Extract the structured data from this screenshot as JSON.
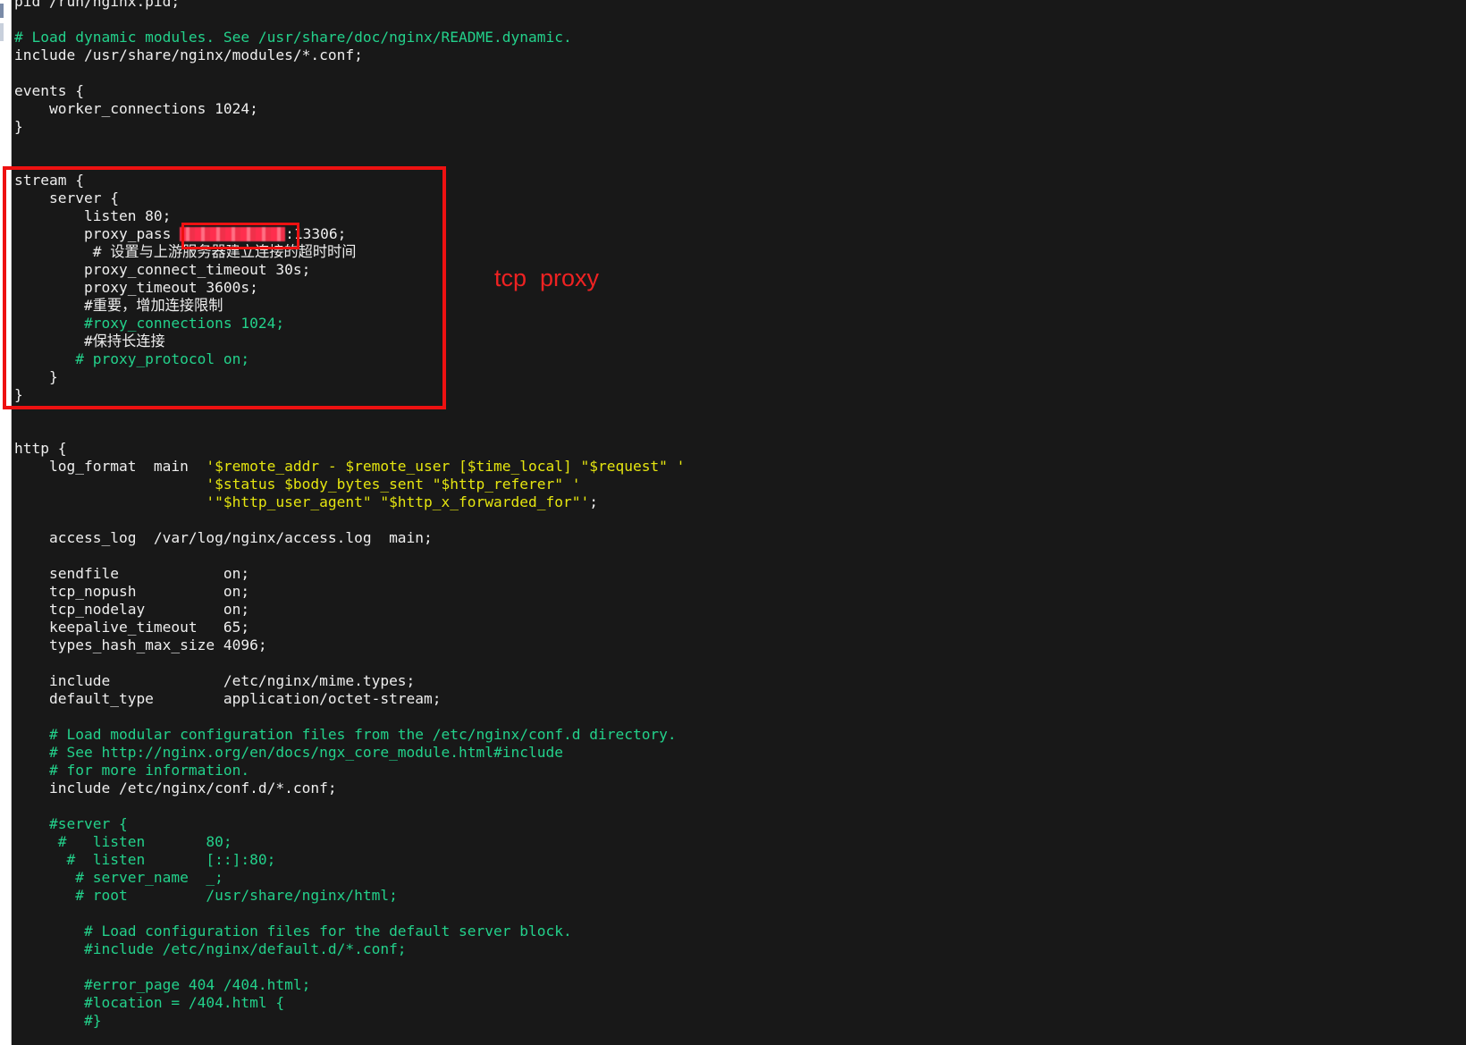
{
  "colors": {
    "background": "#181818",
    "text": "#eeeeee",
    "comment": "#23d18b",
    "string": "#e5e510",
    "annotation": "#ee2222"
  },
  "annotation": {
    "label": "tcp  proxy"
  },
  "code": {
    "lines": [
      [
        {
          "t": "pid /run/nginx.pid;",
          "c": "plain"
        }
      ],
      [],
      [
        {
          "t": "# Load dynamic modules. See /usr/share/doc/nginx/README.dynamic.",
          "c": "comment"
        }
      ],
      [
        {
          "t": "include /usr/share/nginx/modules/*.conf;",
          "c": "plain"
        }
      ],
      [],
      [
        {
          "t": "events {",
          "c": "plain"
        }
      ],
      [
        {
          "t": "    worker_connections 1024;",
          "c": "plain"
        }
      ],
      [
        {
          "t": "}",
          "c": "plain"
        }
      ],
      [],
      [],
      [
        {
          "t": "stream {",
          "c": "plain"
        }
      ],
      [
        {
          "t": "    server {",
          "c": "plain"
        }
      ],
      [
        {
          "t": "        listen 80;",
          "c": "plain"
        }
      ],
      [
        {
          "t": "        proxy_pass ",
          "c": "plain"
        },
        {
          "t": "",
          "c": "redacted"
        },
        {
          "t": ":13306;",
          "c": "plain"
        }
      ],
      [
        {
          "t": "         # 设置与上游服务器建立连接的超时时间",
          "c": "plain"
        }
      ],
      [
        {
          "t": "        proxy_connect_timeout 30s;",
          "c": "plain"
        }
      ],
      [
        {
          "t": "        proxy_timeout 3600s;",
          "c": "plain"
        }
      ],
      [
        {
          "t": "        #重要，增加连接限制",
          "c": "plain"
        }
      ],
      [
        {
          "t": "        #roxy_connections 1024;",
          "c": "comment"
        }
      ],
      [
        {
          "t": "        #保持长连接",
          "c": "plain"
        }
      ],
      [
        {
          "t": "       # proxy_protocol on;",
          "c": "comment"
        }
      ],
      [
        {
          "t": "    }",
          "c": "plain"
        }
      ],
      [
        {
          "t": "}",
          "c": "plain"
        }
      ],
      [],
      [],
      [
        {
          "t": "http {",
          "c": "plain"
        }
      ],
      [
        {
          "t": "    log_format  main  ",
          "c": "plain"
        },
        {
          "t": "'$remote_addr - $remote_user [$time_local] \"$request\" '",
          "c": "str"
        }
      ],
      [
        {
          "t": "                      ",
          "c": "plain"
        },
        {
          "t": "'$status $body_bytes_sent \"$http_referer\" '",
          "c": "str"
        }
      ],
      [
        {
          "t": "                      ",
          "c": "plain"
        },
        {
          "t": "'\"$http_user_agent\" \"$http_x_forwarded_for\"'",
          "c": "str"
        },
        {
          "t": ";",
          "c": "plain"
        }
      ],
      [],
      [
        {
          "t": "    access_log  /var/log/nginx/access.log  main;",
          "c": "plain"
        }
      ],
      [],
      [
        {
          "t": "    sendfile            on;",
          "c": "plain"
        }
      ],
      [
        {
          "t": "    tcp_nopush          on;",
          "c": "plain"
        }
      ],
      [
        {
          "t": "    tcp_nodelay         on;",
          "c": "plain"
        }
      ],
      [
        {
          "t": "    keepalive_timeout   65;",
          "c": "plain"
        }
      ],
      [
        {
          "t": "    types_hash_max_size 4096;",
          "c": "plain"
        }
      ],
      [],
      [
        {
          "t": "    include             /etc/nginx/mime.types;",
          "c": "plain"
        }
      ],
      [
        {
          "t": "    default_type        application/octet-stream;",
          "c": "plain"
        }
      ],
      [],
      [
        {
          "t": "    # Load modular configuration files from the /etc/nginx/conf.d directory.",
          "c": "comment"
        }
      ],
      [
        {
          "t": "    # See http://nginx.org/en/docs/ngx_core_module.html#include",
          "c": "comment"
        }
      ],
      [
        {
          "t": "    # for more information.",
          "c": "comment"
        }
      ],
      [
        {
          "t": "    include /etc/nginx/conf.d/*.conf;",
          "c": "plain"
        }
      ],
      [],
      [
        {
          "t": "    #server {",
          "c": "comment"
        }
      ],
      [
        {
          "t": "     #   listen       80;",
          "c": "comment"
        }
      ],
      [
        {
          "t": "      #  listen       [::]:80;",
          "c": "comment"
        }
      ],
      [
        {
          "t": "       # server_name  _;",
          "c": "comment"
        }
      ],
      [
        {
          "t": "       # root         /usr/share/nginx/html;",
          "c": "comment"
        }
      ],
      [],
      [
        {
          "t": "        # Load configuration files for the default server block.",
          "c": "comment"
        }
      ],
      [
        {
          "t": "        #include /etc/nginx/default.d/*.conf;",
          "c": "comment"
        }
      ],
      [],
      [
        {
          "t": "        #error_page 404 /404.html;",
          "c": "comment"
        }
      ],
      [
        {
          "t": "        #location = /404.html {",
          "c": "comment"
        }
      ],
      [
        {
          "t": "        #}",
          "c": "comment"
        }
      ]
    ]
  }
}
